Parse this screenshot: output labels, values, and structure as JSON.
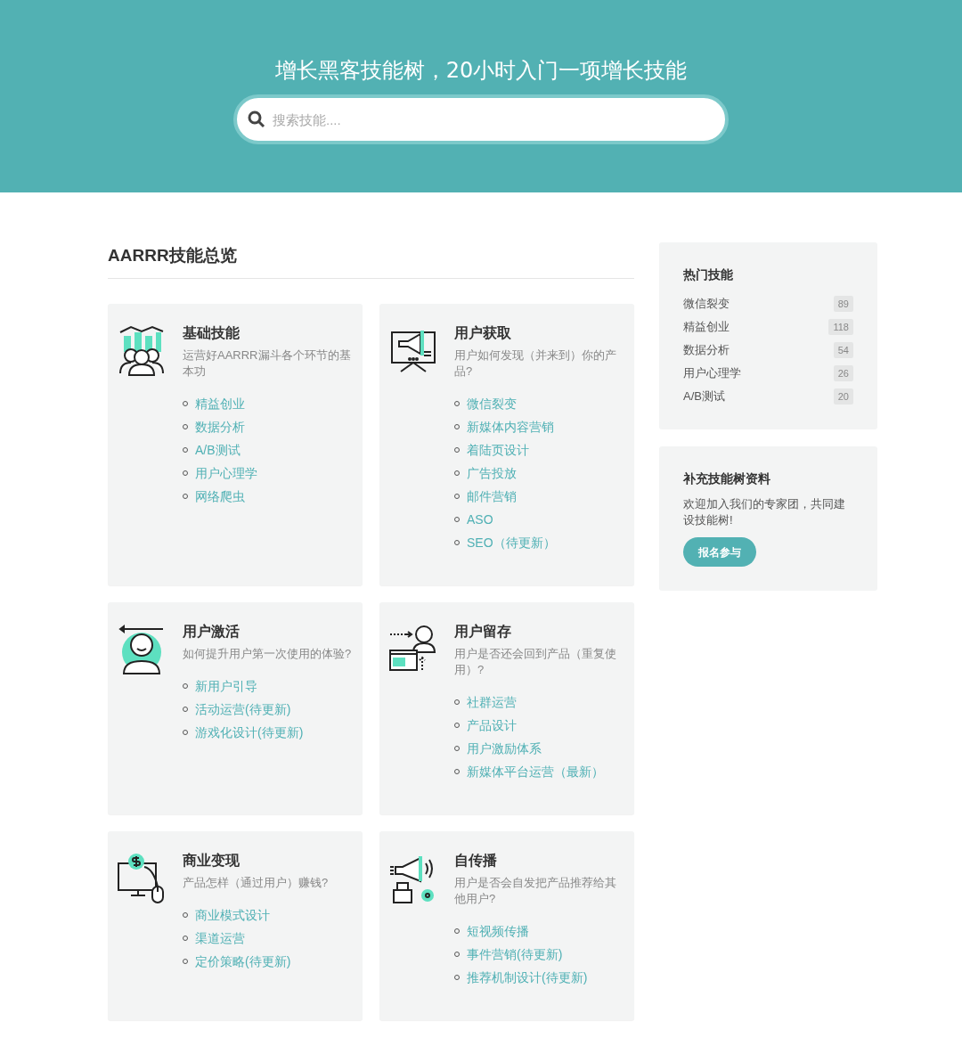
{
  "header": {
    "title": "增长黑客技能树，20小时入门一项增长技能",
    "search": {
      "placeholder": "搜索技能...."
    }
  },
  "overview": {
    "title": "AARRR技能总览",
    "cards": [
      {
        "title": "基础技能",
        "description": "运营好AARRR漏斗各个环节的基本功",
        "links": [
          "精益创业",
          "数据分析",
          "A/B测试",
          "用户心理学",
          "网络爬虫"
        ]
      },
      {
        "title": "用户获取",
        "description": "用户如何发现（并来到）你的产品?",
        "links": [
          "微信裂变",
          "新媒体内容营销",
          "着陆页设计",
          "广告投放",
          "邮件营销",
          "ASO",
          "SEO（待更新）"
        ]
      },
      {
        "title": "用户激活",
        "description": "如何提升用户第一次使用的体验?",
        "links": [
          "新用户引导",
          "活动运营(待更新)",
          "游戏化设计(待更新)"
        ]
      },
      {
        "title": "用户留存",
        "description": "用户是否还会回到产品（重复使用）?",
        "links": [
          "社群运营",
          "产品设计",
          "用户激励体系",
          "新媒体平台运营（最新）"
        ]
      },
      {
        "title": "商业变现",
        "description": "产品怎样（通过用户）赚钱?",
        "links": [
          "商业模式设计",
          "渠道运营",
          "定价策略(待更新)"
        ]
      },
      {
        "title": "自传播",
        "description": "用户是否会自发把产品推荐给其他用户?",
        "links": [
          "短视频传播",
          "事件营销(待更新)",
          "推荐机制设计(待更新)"
        ]
      }
    ]
  },
  "sidebar": {
    "popular": {
      "title": "热门技能",
      "items": [
        {
          "label": "微信裂变",
          "count": "89"
        },
        {
          "label": "精益创业",
          "count": "118"
        },
        {
          "label": "数据分析",
          "count": "54"
        },
        {
          "label": "用户心理学",
          "count": "26"
        },
        {
          "label": "A/B测试",
          "count": "20"
        }
      ]
    },
    "contribute": {
      "title": "补充技能树资料",
      "text": "欢迎加入我们的专家团，共同建设技能树!",
      "button": "报名参与"
    }
  }
}
